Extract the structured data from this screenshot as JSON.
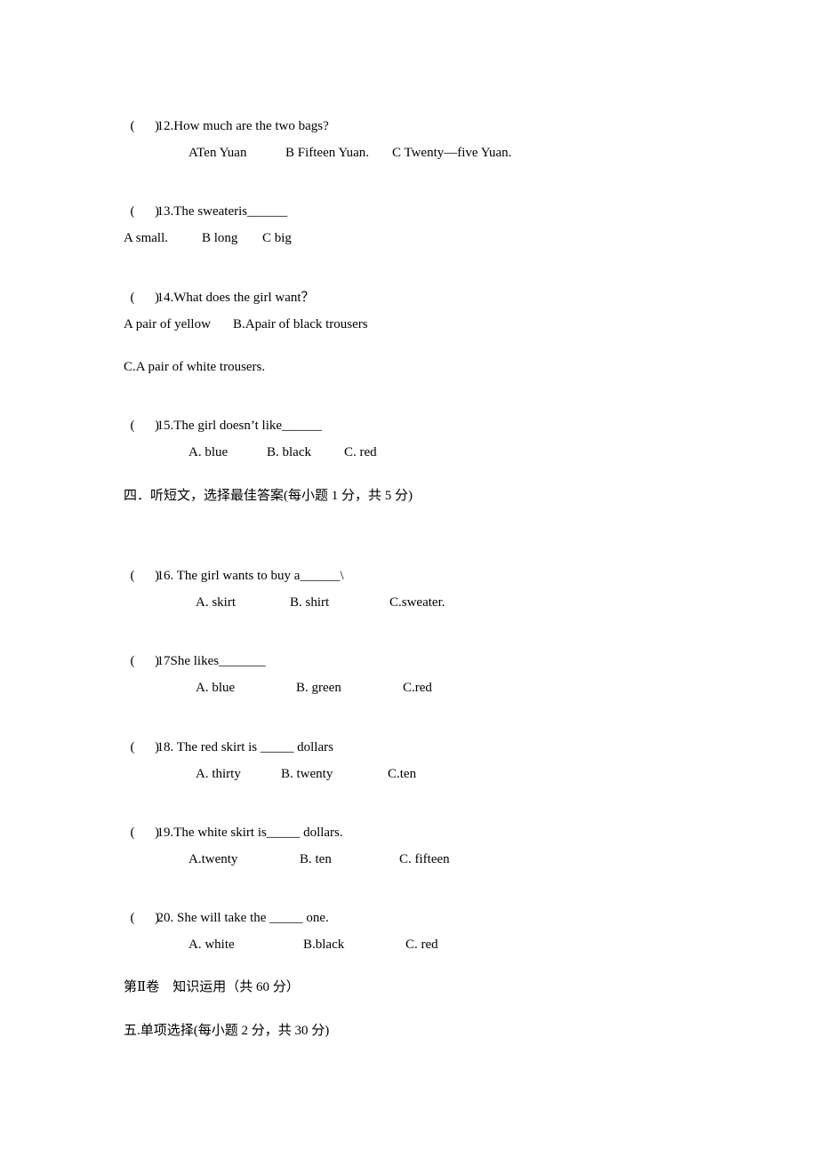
{
  "questions": [
    {
      "paren": "(      )",
      "text": "12.How much are the two bags?",
      "options": [
        "ATen Yuan",
        "B Fifteen Yuan.",
        "C Twenty—five Yuan."
      ]
    },
    {
      "paren": "(      )",
      "text": "13.The sweateris______",
      "options": [
        "A small.",
        "B long",
        "C big"
      ]
    },
    {
      "paren": "(      )",
      "text": "14.What does the girl want？",
      "options": [
        "A pair of yellow",
        "B.Apair of black trousers",
        "C.A pair of white trousers."
      ]
    },
    {
      "paren": "(      )",
      "text": "15.The girl doesn’t like______",
      "options": [
        "A. blue",
        "B. black",
        "C. red"
      ]
    },
    {
      "paren": "(      )",
      "text": "16. The girl wants to buy a______\\",
      "options": [
        "A. skirt",
        "B. shirt",
        "C.sweater."
      ]
    },
    {
      "paren": "(      )",
      "text": "17She likes_______",
      "options": [
        "A. blue",
        "B. green",
        "C.red"
      ]
    },
    {
      "paren": "(      )",
      "text": "18. The red skirt is _____ dollars",
      "options": [
        "A. thirty",
        "B. twenty",
        "C.ten"
      ]
    },
    {
      "paren": "(      )",
      "text": "19.The white skirt is_____ dollars.",
      "options": [
        "A.twenty",
        "B. ten",
        "C. fifteen"
      ]
    },
    {
      "paren": "(      )",
      "text": "20. She will take the _____ one.",
      "options": [
        "A. white",
        "B.black",
        "C. red"
      ]
    }
  ],
  "sections": {
    "section4": "四．听短文，选择最佳答案(每小题 1 分，共 5 分)",
    "part2": "第Ⅱ卷　知识运用（共 60 分）",
    "section5": "五.单项选择(每小题 2 分，共 30 分)"
  }
}
